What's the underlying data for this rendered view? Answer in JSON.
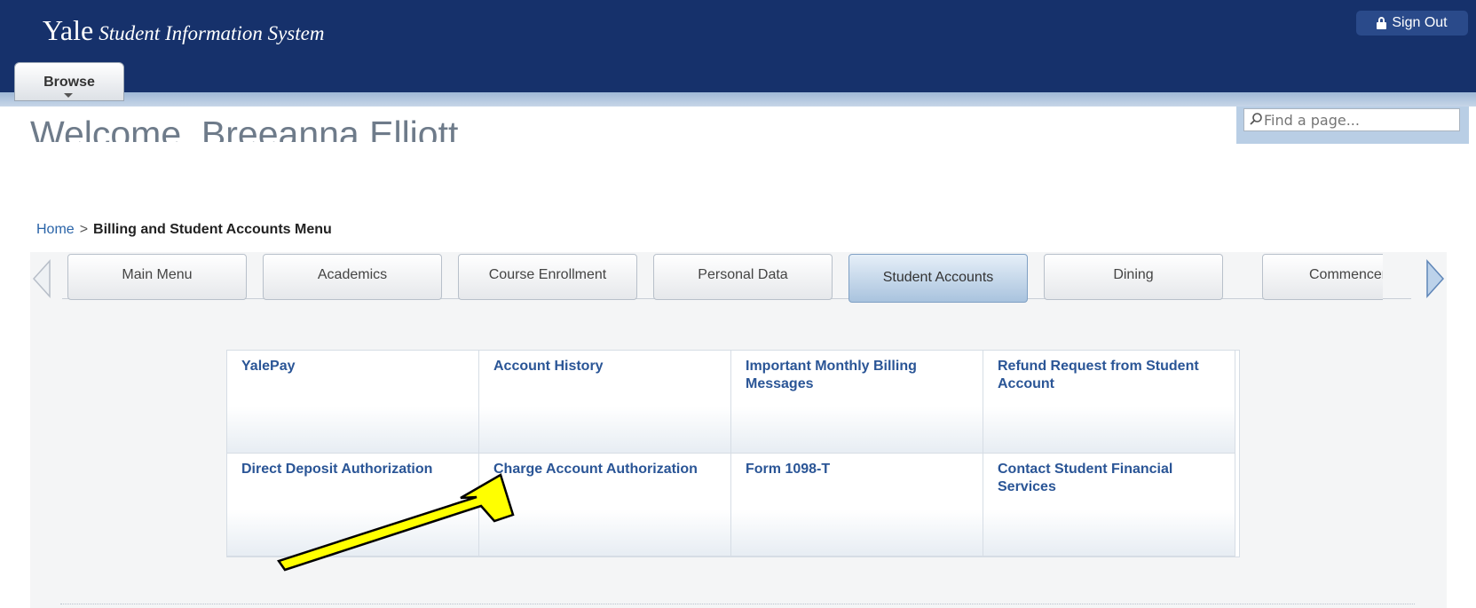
{
  "header": {
    "brand_main": "Yale",
    "brand_sub": "Student Information System",
    "sign_out_label": "Sign Out",
    "browse_label": "Browse",
    "welcome_text": "Welcome, Breeanna Elliott",
    "search_placeholder": "Find a page..."
  },
  "breadcrumb": {
    "home": "Home",
    "separator": ">",
    "current": "Billing and Student Accounts Menu"
  },
  "tabs": [
    {
      "label": "Main Menu",
      "active": false
    },
    {
      "label": "Academics",
      "active": false
    },
    {
      "label": "Course Enrollment",
      "active": false
    },
    {
      "label": "Personal Data",
      "active": false
    },
    {
      "label": "Student Accounts",
      "active": true
    },
    {
      "label": "Dining",
      "active": false
    },
    {
      "label": "Commencement",
      "active": false
    }
  ],
  "tiles": [
    [
      "YalePay",
      "Account History",
      "Important Monthly Billing Messages",
      "Refund Request from Student Account"
    ],
    [
      "Direct Deposit Authorization",
      "Charge Account Authorization",
      "Form 1098-T",
      "Contact Student Financial Services"
    ]
  ],
  "icons": {
    "lock": "lock-icon",
    "search": "search-icon",
    "prev": "chevron-left-icon",
    "next": "chevron-right-icon",
    "annotation": "arrow-annotation"
  },
  "colors": {
    "header": "#16316b",
    "link": "#2a5596",
    "active_tab": "#a9c3de",
    "annotation_arrow": "#ffff00"
  }
}
